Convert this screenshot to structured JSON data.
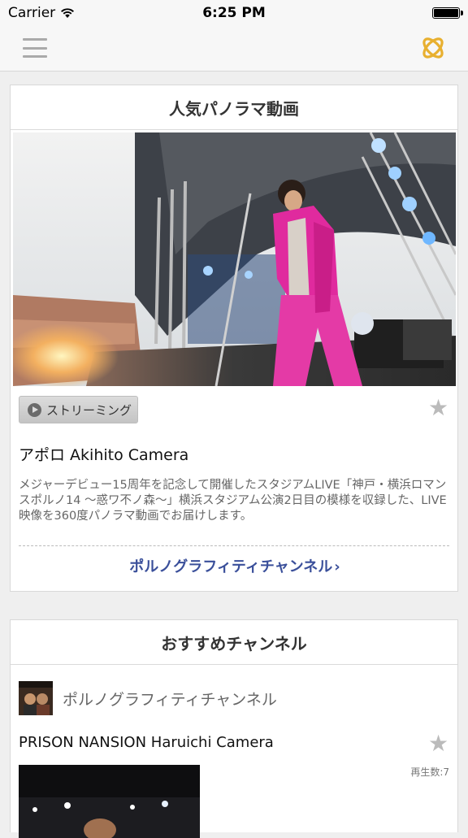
{
  "status_bar": {
    "carrier": "Carrier",
    "time": "6:25 PM"
  },
  "navbar": {
    "menu_icon": "hamburger-icon",
    "logo_icon": "app-logo-icon",
    "logo_color": "#e8b030"
  },
  "popular": {
    "header": "人気パノラマ動画",
    "stream_button": "ストリーミング",
    "item_title": "アポロ Akihito Camera",
    "item_desc": "メジャーデビュー15周年を記念して開催したスタジアムLIVE「神戸・横浜ロマンスポルノ14 ～惑ワ不ノ森～」横浜スタジアム公演2日目の模様を収録した、LIVE映像を360度パノラマ動画でお届けします。",
    "channel_link": "ポルノグラフィティチャンネル",
    "channel_link_chevron": "›",
    "link_color": "#3a4f9a"
  },
  "recommended": {
    "header": "おすすめチャンネル",
    "channel_name": "ポルノグラフィティチャンネル",
    "item_title": "PRISON NANSION Haruichi Camera",
    "play_count": "再生数:7"
  },
  "icons": {
    "star": "★"
  }
}
